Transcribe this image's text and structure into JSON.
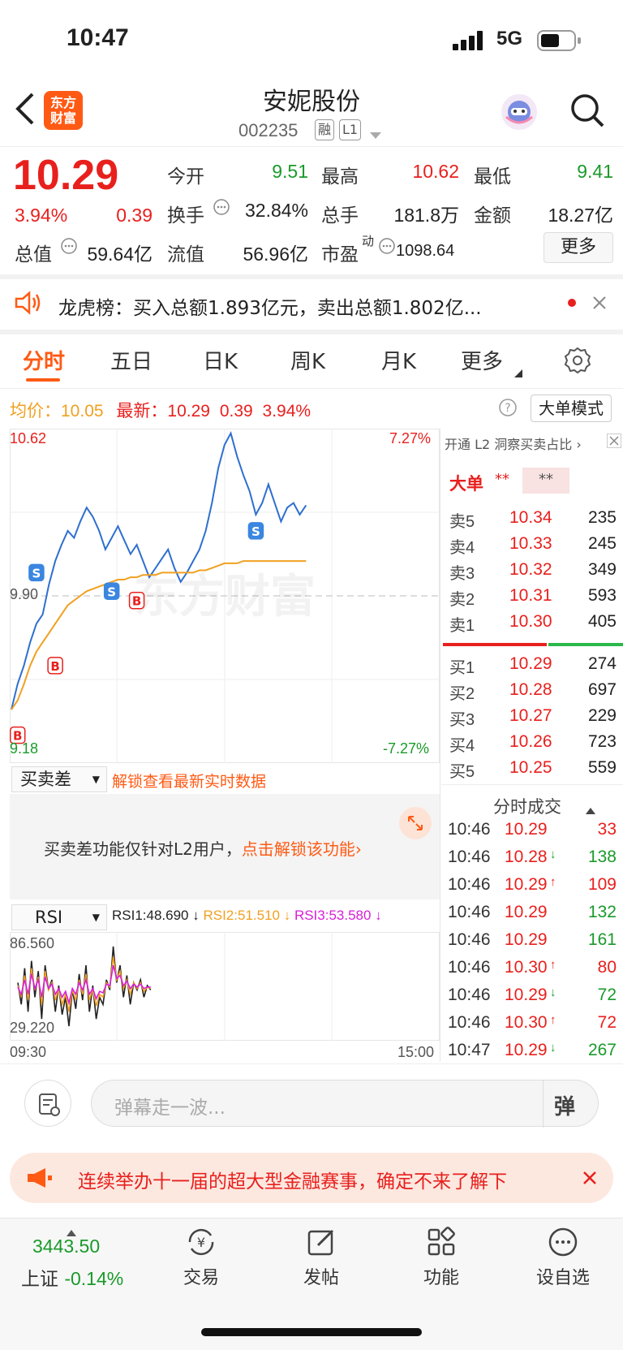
{
  "status": {
    "time": "10:47",
    "network": "5G"
  },
  "header": {
    "logo": "东方\n财富",
    "logo_line1": "东方",
    "logo_line2": "财富",
    "title": "安妮股份",
    "code": "002235",
    "tag_margin": "融",
    "tag_level": "L1"
  },
  "quote": {
    "price": "10.29",
    "change_pct": "3.94%",
    "change": "0.39",
    "open_label": "今开",
    "open": "9.51",
    "high_label": "最高",
    "high": "10.62",
    "low_label": "最低",
    "low": "9.41",
    "turnover_label": "换手",
    "turnover": "32.84%",
    "volume_label": "总手",
    "volume": "181.8万",
    "amount_label": "金额",
    "amount": "18.27亿",
    "mktcap_label": "总值",
    "mktcap": "59.64亿",
    "float_label": "流值",
    "float": "56.96亿",
    "pe_label": "市盈",
    "pe_sup": "动",
    "pe": "1098.64",
    "more_button": "更多"
  },
  "notice": {
    "text": "龙虎榜：买入总额1.893亿元，卖出总额1.802亿..."
  },
  "tabs": [
    "分时",
    "五日",
    "日K",
    "周K",
    "月K",
    "更多"
  ],
  "chart_info": {
    "avg_label": "均价：",
    "avg": "10.05",
    "latest_label": "最新：",
    "latest": "10.29",
    "change": "0.39",
    "pct": "3.94%",
    "mode_button": "大单模式"
  },
  "chart_data": {
    "type": "line",
    "title": "",
    "y_top_label": "10.62",
    "y_mid_label": "9.90",
    "y_bottom_label": "9.18",
    "pct_top": "7.27%",
    "pct_bottom": "-7.27%",
    "x_start": "09:30",
    "x_end": "15:00",
    "ylim": [
      9.18,
      10.62
    ],
    "watermark": "东方财富",
    "series": [
      {
        "values": [
          9.41,
          9.52,
          9.6,
          9.7,
          9.78,
          9.82,
          9.95,
          10.05,
          10.12,
          10.18,
          10.15,
          10.22,
          10.28,
          10.24,
          10.18,
          10.1,
          10.15,
          10.2,
          10.14,
          10.08,
          10.12,
          10.05,
          9.98,
          10.02,
          10.06,
          10.1,
          10.02,
          9.96,
          10.0,
          10.05,
          10.1,
          10.18,
          10.3,
          10.45,
          10.55,
          10.6,
          10.5,
          10.42,
          10.35,
          10.25,
          10.3,
          10.38,
          10.3,
          10.22,
          10.28,
          10.3,
          10.25,
          10.29
        ]
      },
      {
        "values": [
          9.41,
          9.45,
          9.52,
          9.6,
          9.66,
          9.7,
          9.74,
          9.78,
          9.82,
          9.86,
          9.88,
          9.9,
          9.92,
          9.93,
          9.94,
          9.95,
          9.96,
          9.97,
          9.97,
          9.98,
          9.98,
          9.99,
          9.99,
          9.99,
          10.0,
          10.0,
          10.0,
          10.0,
          10.0,
          10.0,
          10.01,
          10.01,
          10.02,
          10.03,
          10.04,
          10.04,
          10.04,
          10.05,
          10.05,
          10.05,
          10.05,
          10.05,
          10.05,
          10.05,
          10.05,
          10.05,
          10.05,
          10.05
        ]
      }
    ],
    "markers": [
      {
        "label": "S",
        "index": 4,
        "value": 10.0
      },
      {
        "label": "S",
        "index": 16,
        "value": 9.92
      },
      {
        "label": "S",
        "index": 39,
        "value": 10.18
      },
      {
        "label": "B",
        "index": 1,
        "value": 9.3
      },
      {
        "label": "B",
        "index": 7,
        "value": 9.6
      },
      {
        "label": "B",
        "index": 20,
        "value": 9.88
      }
    ]
  },
  "spread_panel": {
    "select": "买卖差",
    "unlock_link": "解锁查看最新实时数据",
    "message": "买卖差功能仅针对L2用户，",
    "message_link": "点击解锁该功能"
  },
  "rsi_panel": {
    "select": "RSI",
    "rsi1": "RSI1:48.690",
    "rsi2": "RSI2:51.510",
    "rsi3": "RSI3:53.580",
    "top_label": "86.560",
    "bottom_label": "29.220",
    "series": [
      {
        "name": "RSI1",
        "values": [
          60,
          45,
          70,
          40,
          75,
          50,
          68,
          35,
          72,
          55,
          62,
          40,
          58,
          38,
          50,
          30,
          55,
          42,
          66,
          48,
          72,
          40,
          58,
          35,
          50,
          45,
          62,
          55,
          85,
          60,
          72,
          50,
          65,
          45,
          60,
          55,
          62,
          50,
          58,
          55
        ]
      },
      {
        "name": "RSI2",
        "values": [
          58,
          50,
          65,
          48,
          70,
          55,
          64,
          45,
          68,
          55,
          60,
          48,
          56,
          45,
          52,
          40,
          55,
          48,
          62,
          52,
          66,
          48,
          56,
          44,
          52,
          50,
          60,
          57,
          78,
          62,
          68,
          56,
          62,
          52,
          60,
          56,
          60,
          54,
          57,
          56
        ]
      },
      {
        "name": "RSI3",
        "values": [
          57,
          52,
          62,
          52,
          66,
          56,
          62,
          50,
          64,
          56,
          59,
          52,
          56,
          50,
          54,
          46,
          56,
          52,
          60,
          55,
          62,
          52,
          56,
          49,
          54,
          53,
          59,
          58,
          72,
          63,
          65,
          58,
          61,
          56,
          59,
          57,
          59,
          56,
          57,
          57
        ]
      }
    ]
  },
  "orderbook": {
    "promo": "开通 L2 洞察买卖占比",
    "big_order_label": "大单",
    "big_order_red": "**",
    "big_order_green": "**",
    "asks": [
      {
        "label": "卖5",
        "price": "10.34",
        "vol": "235"
      },
      {
        "label": "卖4",
        "price": "10.33",
        "vol": "245"
      },
      {
        "label": "卖3",
        "price": "10.32",
        "vol": "349"
      },
      {
        "label": "卖2",
        "price": "10.31",
        "vol": "593"
      },
      {
        "label": "卖1",
        "price": "10.30",
        "vol": "405"
      }
    ],
    "bids": [
      {
        "label": "买1",
        "price": "10.29",
        "vol": "274"
      },
      {
        "label": "买2",
        "price": "10.28",
        "vol": "697"
      },
      {
        "label": "买3",
        "price": "10.27",
        "vol": "229"
      },
      {
        "label": "买4",
        "price": "10.26",
        "vol": "723"
      },
      {
        "label": "买5",
        "price": "10.25",
        "vol": "559"
      }
    ]
  },
  "ticks": {
    "title": "分时成交",
    "rows": [
      {
        "time": "10:46",
        "price": "10.29",
        "arrow": "",
        "vol": "33",
        "color": "red"
      },
      {
        "time": "10:46",
        "price": "10.28",
        "arrow": "↓",
        "vol": "138",
        "color": "green"
      },
      {
        "time": "10:46",
        "price": "10.29",
        "arrow": "↑",
        "vol": "109",
        "color": "red"
      },
      {
        "time": "10:46",
        "price": "10.29",
        "arrow": "",
        "vol": "132",
        "color": "green"
      },
      {
        "time": "10:46",
        "price": "10.29",
        "arrow": "",
        "vol": "161",
        "color": "green"
      },
      {
        "time": "10:46",
        "price": "10.30",
        "arrow": "↑",
        "vol": "80",
        "color": "red"
      },
      {
        "time": "10:46",
        "price": "10.29",
        "arrow": "↓",
        "vol": "72",
        "color": "green"
      },
      {
        "time": "10:46",
        "price": "10.30",
        "arrow": "↑",
        "vol": "72",
        "color": "red"
      },
      {
        "time": "10:47",
        "price": "10.29",
        "arrow": "↓",
        "vol": "267",
        "color": "green"
      }
    ]
  },
  "comment_bar": {
    "placeholder": "弹幕走一波...",
    "danmu_icon": "弹"
  },
  "ad_banner": {
    "text": "连续举办十一届的超大型金融赛事，确定不来了解下"
  },
  "bottom_nav": {
    "index_value": "3443.50",
    "index_name": "上证",
    "index_change": "-0.14%",
    "items": [
      "交易",
      "发帖",
      "功能",
      "设自选"
    ]
  },
  "colors": {
    "up": "#e8201d",
    "down": "#1a9a2a",
    "price_line": "#2e6fcf",
    "avg_line": "#f0a020",
    "accent": "#ff6a00"
  }
}
